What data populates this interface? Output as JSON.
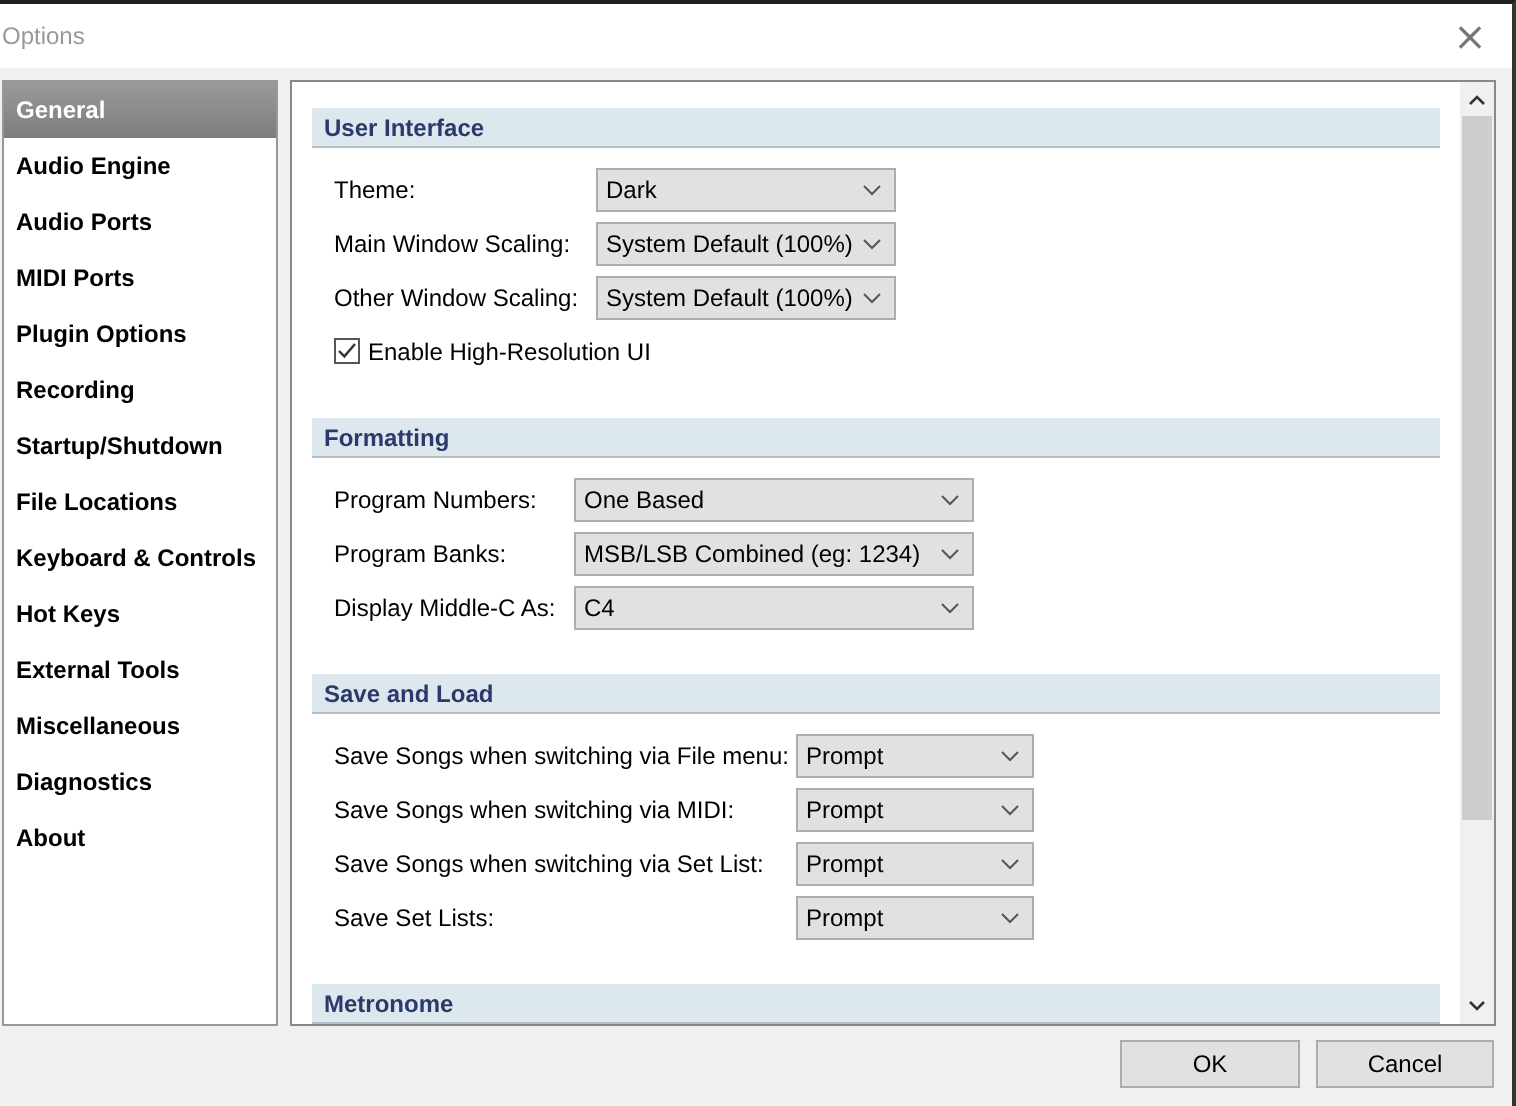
{
  "window": {
    "title": "Options",
    "close": "×"
  },
  "sidebar": {
    "items": [
      {
        "label": "General",
        "selected": true
      },
      {
        "label": "Audio Engine",
        "selected": false
      },
      {
        "label": "Audio Ports",
        "selected": false
      },
      {
        "label": "MIDI Ports",
        "selected": false
      },
      {
        "label": "Plugin Options",
        "selected": false
      },
      {
        "label": "Recording",
        "selected": false
      },
      {
        "label": "Startup/Shutdown",
        "selected": false
      },
      {
        "label": "File Locations",
        "selected": false
      },
      {
        "label": "Keyboard & Controls",
        "selected": false
      },
      {
        "label": "Hot Keys",
        "selected": false
      },
      {
        "label": "External Tools",
        "selected": false
      },
      {
        "label": "Miscellaneous",
        "selected": false
      },
      {
        "label": "Diagnostics",
        "selected": false
      },
      {
        "label": "About",
        "selected": false
      }
    ]
  },
  "sections": [
    {
      "title": "User Interface",
      "rows": [
        {
          "kind": "dropdown",
          "label": "Theme:",
          "value": "Dark"
        },
        {
          "kind": "dropdown",
          "label": "Main Window Scaling:",
          "value": "System Default (100%)"
        },
        {
          "kind": "dropdown",
          "label": "Other Window Scaling:",
          "value": "System Default (100%)"
        },
        {
          "kind": "checkbox",
          "label": "Enable High-Resolution UI",
          "checked": true
        }
      ]
    },
    {
      "title": "Formatting",
      "rows": [
        {
          "kind": "dropdown",
          "label": "Program Numbers:",
          "value": "One Based"
        },
        {
          "kind": "dropdown",
          "label": "Program Banks:",
          "value": "MSB/LSB Combined (eg: 1234)"
        },
        {
          "kind": "dropdown",
          "label": "Display Middle-C As:",
          "value": "C4"
        }
      ]
    },
    {
      "title": "Save and Load",
      "rows": [
        {
          "kind": "dropdown",
          "label": "Save Songs when switching via File menu:",
          "value": "Prompt"
        },
        {
          "kind": "dropdown",
          "label": "Save Songs when switching via MIDI:",
          "value": "Prompt"
        },
        {
          "kind": "dropdown",
          "label": "Save Songs when switching via Set List:",
          "value": "Prompt"
        },
        {
          "kind": "dropdown",
          "label": "Save Set Lists:",
          "value": "Prompt"
        }
      ]
    },
    {
      "title": "Metronome"
    }
  ],
  "buttons": [
    "OK",
    "Cancel"
  ]
}
